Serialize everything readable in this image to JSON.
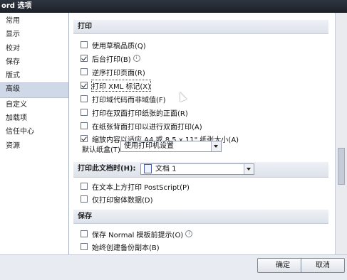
{
  "title": "ord 选项",
  "nav": {
    "items": [
      {
        "label": "常用",
        "selected": false
      },
      {
        "label": "显示",
        "selected": false
      },
      {
        "label": "校对",
        "selected": false
      },
      {
        "label": "保存",
        "selected": false
      },
      {
        "label": "版式",
        "selected": false
      },
      {
        "label": "高级",
        "selected": true
      },
      {
        "label": "自定义",
        "selected": false
      },
      {
        "label": "加载项",
        "selected": false
      },
      {
        "label": "信任中心",
        "selected": false
      },
      {
        "label": "资源",
        "selected": false
      }
    ]
  },
  "print_section": {
    "header": "打印",
    "options": [
      {
        "label": "使用草稿品质(Q)",
        "checked": false
      },
      {
        "label": "后台打印(B)",
        "checked": true
      },
      {
        "label": "逆序打印页面(R)",
        "checked": false
      },
      {
        "label": "打印 XML 标记(X)",
        "checked": true
      },
      {
        "label": "打印域代码而非域值(F)",
        "checked": false
      },
      {
        "label": "打印在双面打印纸张的正面(R)",
        "checked": false
      },
      {
        "label": "在纸张背面打印以进行双面打印(A)",
        "checked": false
      },
      {
        "label": "缩放内容以适应 A4 或 8.5 x 11\" 纸张大小(A)",
        "checked": true
      }
    ],
    "default_tray_label": "默认纸盒(T):",
    "default_tray_value": "使用打印机设置"
  },
  "doc_print_section": {
    "label": "打印此文档时(H):",
    "value": "文档 1",
    "options": [
      {
        "label": "在文本上方打印 PostScript(P)",
        "checked": false
      },
      {
        "label": "仅打印窗体数据(D)",
        "checked": false
      }
    ]
  },
  "save_section": {
    "header": "保存",
    "options": [
      {
        "label": "保存 Normal 模板前提示(O)",
        "checked": false
      },
      {
        "label": "始终创建备份副本(B)",
        "checked": false
      }
    ]
  },
  "buttons": {
    "ok": "确定",
    "cancel": "取消"
  }
}
